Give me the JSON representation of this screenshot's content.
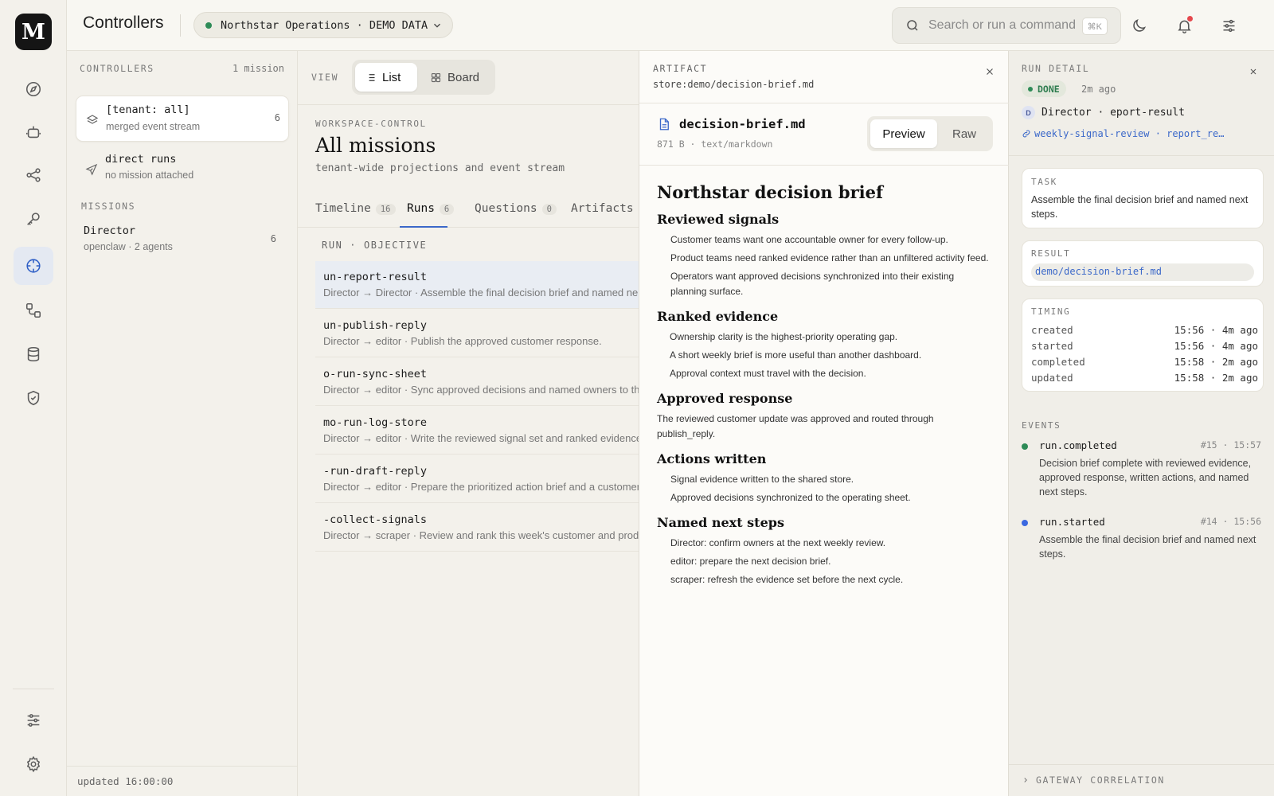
{
  "rail": {
    "logo": "M",
    "icons": [
      "compass-icon",
      "bot-icon",
      "share-icon",
      "key-icon",
      "crosshair-icon",
      "workflow-icon",
      "database-icon",
      "shield-check-icon",
      "sliders-icon",
      "gear-icon"
    ],
    "active": "crosshair-icon"
  },
  "header": {
    "title": "Controllers",
    "tenant": "Northstar Operations · DEMO DATA",
    "search_placeholder": "Search or run a command",
    "shortcut": "⌘K",
    "status_color": "#2e8b57",
    "notification_color": "#e5484d"
  },
  "controllers": {
    "heading": "CONTROLLERS",
    "count": "1 mission",
    "items": [
      {
        "title": "[tenant: all]",
        "subtitle": "merged event stream",
        "count": "6"
      },
      {
        "title": "direct runs",
        "subtitle": "no mission attached",
        "count": ""
      }
    ],
    "missions_heading": "MISSIONS",
    "missions": [
      {
        "title": "Director",
        "subtitle": "openclaw · 2 agents",
        "count": "6"
      }
    ],
    "footer": "updated 16:00:00"
  },
  "view": {
    "label": "VIEW",
    "list": "List",
    "board": "Board"
  },
  "workspace": {
    "kicker": "WORKSPACE-CONTROL",
    "title": "All missions",
    "subtitle": "tenant-wide projections and event stream"
  },
  "tabs": [
    {
      "label": "Timeline",
      "count": "16"
    },
    {
      "label": "Runs",
      "count": "6"
    },
    {
      "label": "Questions",
      "count": "0"
    },
    {
      "label": "Artifacts",
      "count": ""
    }
  ],
  "runs": {
    "heading": "RUN · OBJECTIVE",
    "items": [
      {
        "name": "un-report-result",
        "sub": "Director → Director · Assemble the final decision brief and named ne"
      },
      {
        "name": "un-publish-reply",
        "sub": "Director → editor · Publish the approved customer response."
      },
      {
        "name": "o-run-sync-sheet",
        "sub": "Director → editor · Sync approved decisions and named owners to th"
      },
      {
        "name": "mo-run-log-store",
        "sub": "Director → editor · Write the reviewed signal set and ranked evidence"
      },
      {
        "name": "-run-draft-reply",
        "sub": "Director → editor · Prepare the prioritized action brief and a customer"
      },
      {
        "name": "-collect-signals",
        "sub": "Director → scraper · Review and rank this week's customer and prod"
      }
    ]
  },
  "artifact": {
    "heading": "ARTIFACT",
    "path": "store:demo/decision-brief.md",
    "file_name": "decision-brief.md",
    "file_meta": "871 B · text/markdown",
    "preview": "Preview",
    "raw": "Raw",
    "doc": {
      "title": "Northstar decision brief",
      "s1": "Reviewed signals",
      "s1_items": [
        "Customer teams want one accountable owner for every follow-up.",
        "Product teams need ranked evidence rather than an unfiltered activity feed.",
        "Operators want approved decisions synchronized into their existing planning surface."
      ],
      "s2": "Ranked evidence",
      "s2_items": [
        "Ownership clarity is the highest-priority operating gap.",
        "A short weekly brief is more useful than another dashboard.",
        "Approval context must travel with the decision."
      ],
      "s3": "Approved response",
      "s3_text": "The reviewed customer update was approved and routed through publish_reply.",
      "s4": "Actions written",
      "s4_items": [
        "Signal evidence written to the shared store.",
        "Approved decisions synchronized to the operating sheet."
      ],
      "s5": "Named next steps",
      "s5_items": [
        "Director: confirm owners at the next weekly review.",
        "editor: prepare the next decision brief.",
        "scraper: refresh the evidence set before the next cycle."
      ]
    }
  },
  "detail": {
    "heading": "RUN DETAIL",
    "status": "DONE",
    "status_color": "#2e8b57",
    "age": "2m ago",
    "avatar": "D",
    "agent": "Director · eport-result",
    "link": "weekly-signal-review · report_re…",
    "task_label": "TASK",
    "task": "Assemble the final decision brief and named next steps.",
    "result_label": "RESULT",
    "result": "demo/decision-brief.md",
    "timing_label": "TIMING",
    "timing": [
      {
        "k": "created",
        "v": "15:56 · 4m ago"
      },
      {
        "k": "started",
        "v": "15:56 · 4m ago"
      },
      {
        "k": "completed",
        "v": "15:58 · 2m ago"
      },
      {
        "k": "updated",
        "v": "15:58 · 2m ago"
      }
    ],
    "events_label": "EVENTS",
    "events": [
      {
        "name": "run.completed",
        "meta": "#15 · 15:57",
        "text": "Decision brief complete with reviewed evidence, approved response, written actions, and named next steps.",
        "color": "#2e8b57"
      },
      {
        "name": "run.started",
        "meta": "#14 · 15:56",
        "text": "Assemble the final decision brief and named next steps.",
        "color": "#3b68e0"
      }
    ],
    "gateway": "GATEWAY CORRELATION"
  }
}
